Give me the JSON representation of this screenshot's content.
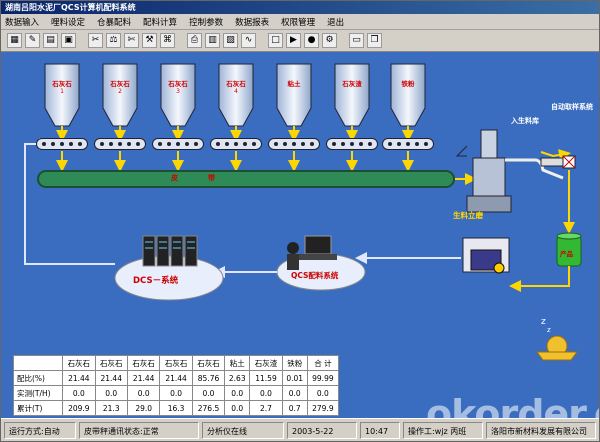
{
  "window": {
    "title": "湖南吕阳水泥厂QCS计算机配料系统"
  },
  "menu": [
    "数据输入",
    "哩料设定",
    "仓暴配料",
    "配料计算",
    "控制参数",
    "数据报表",
    "权限管理",
    "退出"
  ],
  "toolbar_icons": [
    "calculator-icon",
    "pen-icon",
    "document-icon",
    "save-icon",
    "cut-icon",
    "scale-icon",
    "scissors-icon",
    "tools-icon",
    "network-icon",
    "print-icon",
    "archive-icon",
    "chart-icon",
    "graph-icon",
    "page-icon",
    "play-icon",
    "record-icon",
    "gear-icon",
    "monitor-icon",
    "window-icon"
  ],
  "silos": [
    {
      "label": "石灰石",
      "num": "1"
    },
    {
      "label": "石灰石",
      "num": "2"
    },
    {
      "label": "石灰石",
      "num": "3"
    },
    {
      "label": "石灰石",
      "num": "4"
    },
    {
      "label": "粘土",
      "num": ""
    },
    {
      "label": "石灰渣",
      "num": ""
    },
    {
      "label": "铁粉",
      "num": ""
    }
  ],
  "belt_label": "皮带",
  "mill_label": "生料立磨",
  "right_labels": {
    "raw_material": "入生料库",
    "auto_sampling": "自动取样系统"
  },
  "dcs_label": "DCS－系统",
  "qcs_label": "QCS配料系统",
  "tank_label": "产品",
  "table": {
    "headers": [
      "",
      "石灰石",
      "石灰石",
      "石灰石",
      "石灰石",
      "石灰石",
      "粘土",
      "石灰渣",
      "铁粉",
      "合 计"
    ],
    "rows": [
      {
        "label": "配比(%)",
        "values": [
          "21.44",
          "21.44",
          "21.44",
          "21.44",
          "85.76",
          "2.63",
          "11.59",
          "0.01",
          "99.99"
        ]
      },
      {
        "label": "实测(T/H)",
        "values": [
          "0.0",
          "0.0",
          "0.0",
          "0.0",
          "0.0",
          "0.0",
          "0.0",
          "0.0",
          "0.0"
        ]
      },
      {
        "label": "累计(T)",
        "values": [
          "209.9",
          "21.3",
          "29.0",
          "16.3",
          "276.5",
          "0.0",
          "2.7",
          "0.7",
          "279.9"
        ]
      }
    ]
  },
  "status": {
    "run_mode": "运行方式:自动",
    "belt_status": "皮带秤通讯状态:正常",
    "analyzer": "分析仪在线",
    "date": "2003-5-22",
    "time": "10:47",
    "operator": "操作工:wjz 丙班",
    "extra": "洛阳市新材料发展有限公司"
  },
  "watermark": {
    "text": "okorder.com",
    "sub": "okorder.com"
  },
  "colors": {
    "background": "#3a6dbf",
    "belt": "#2e8b57",
    "flow_arrow": "#ffd700",
    "return_line": "#dfe8ff",
    "dcs_ellipse": "#e8eefc"
  }
}
